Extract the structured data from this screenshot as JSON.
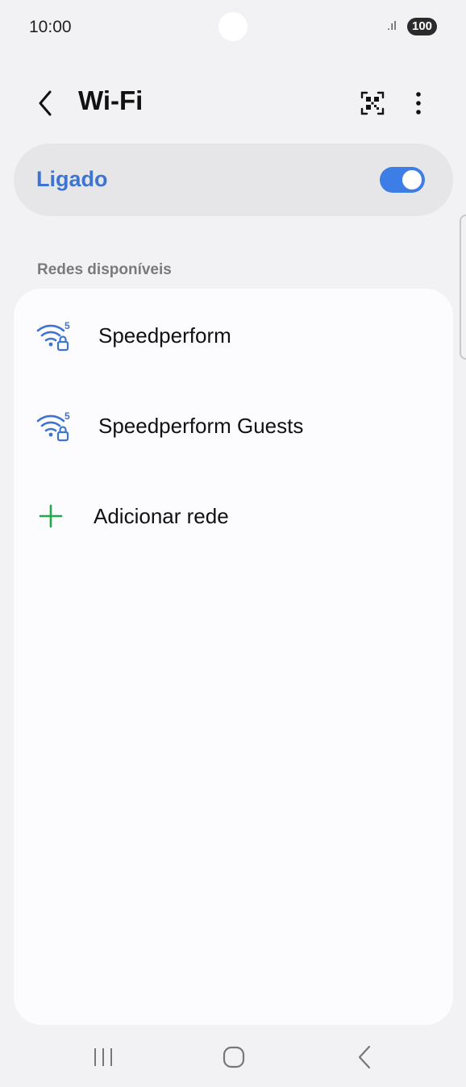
{
  "status_bar": {
    "time": "10:00",
    "signal": ".ıl",
    "battery": "100"
  },
  "header": {
    "title": "Wi-Fi",
    "back_icon": "back-arrow-icon",
    "qr_icon": "qr-scan-icon",
    "more_icon": "more-vertical-icon"
  },
  "wifi_toggle": {
    "label": "Ligado",
    "state": "on",
    "accent": "#3d7ee6"
  },
  "networks": {
    "section_title": "Redes disponíveis",
    "items": [
      {
        "name": "Speedperform",
        "icon": "wifi-5ghz-locked-icon"
      },
      {
        "name": "Speedperform Guests",
        "icon": "wifi-5ghz-locked-icon"
      }
    ],
    "add_label": "Adicionar rede",
    "add_icon": "plus-icon",
    "add_color": "#1fa84c"
  },
  "nav_bar": {
    "recents": "recents-icon",
    "home": "home-icon",
    "back": "back-icon"
  }
}
